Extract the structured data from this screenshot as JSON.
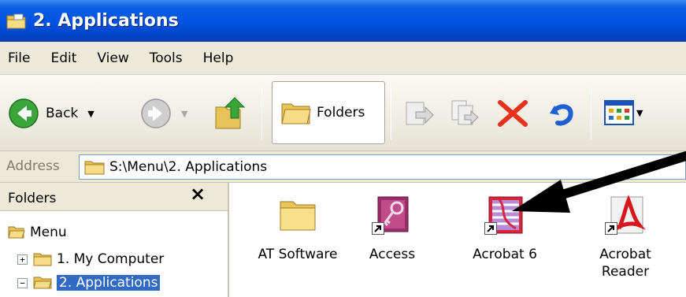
{
  "window": {
    "title": "2. Applications"
  },
  "menu": [
    "File",
    "Edit",
    "View",
    "Tools",
    "Help"
  ],
  "toolbar": {
    "back_label": "Back",
    "folders_label": "Folders"
  },
  "address": {
    "label": "Address",
    "path": "S:\\Menu\\2. Applications"
  },
  "folders_pane": {
    "title": "Folders",
    "close_glyph": "×",
    "tree": [
      {
        "label": "Menu",
        "expander": ""
      },
      {
        "label": "1. My Computer",
        "expander": "+"
      },
      {
        "label": "2. Applications",
        "expander": "−",
        "selected": true
      }
    ]
  },
  "items": [
    {
      "label": "AT Software",
      "icon": "folder-icon",
      "shortcut": false
    },
    {
      "label": "Access",
      "icon": "access-icon",
      "shortcut": true
    },
    {
      "label": "Acrobat 6",
      "icon": "acrobat-icon",
      "shortcut": true
    },
    {
      "label": "Acrobat Reader",
      "icon": "acrobat-reader-icon",
      "shortcut": true
    }
  ],
  "colors": {
    "titlebar": "#0054e3",
    "chrome": "#ece9d8",
    "selection": "#316ac5",
    "delete_red": "#e8331c"
  }
}
